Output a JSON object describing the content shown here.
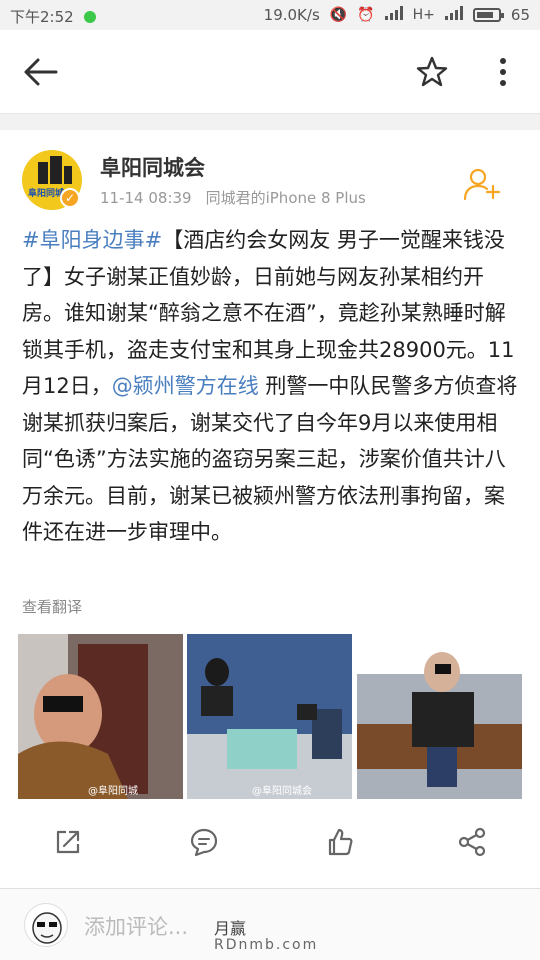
{
  "status_bar": {
    "time": "下午2:52",
    "speed": "19.0K/s",
    "network": "H+",
    "battery": "65"
  },
  "post": {
    "author": "阜阳同城会",
    "avatar_text": "阜阳同城",
    "time": "11-14 08:39",
    "source": "同城君的iPhone 8 Plus",
    "hashtag": "#阜阳身边事#",
    "text_part1": "【酒店约会女网友 男子一觉醒来钱没了】女子谢某正值妙龄，日前她与网友孙某相约开房。谁知谢某“醉翁之意不在酒”，竟趁孙某熟睡时解锁其手机，盗走支付宝和其身上现金共28900元。11月12日，",
    "mention": "@颍州警方在线",
    "text_part2": " 刑警一中队民警多方侦查将谢某抓获归案后，谢某交代了自今年9月以来使用相同“色诱”方法实施的盗窃另案三起，涉案价值共计八万余元。目前，谢某已被颍州警方依法刑事拘留，案件还在进一步审理中。",
    "translate": "查看翻译",
    "photo_watermark_1": "@阜阳同城",
    "photo_watermark_2": "@阜阳同城会"
  },
  "comment_bar": {
    "placeholder": "添加评论...",
    "watermark_top": "月赢",
    "watermark_bottom": "RDnmb.com"
  },
  "icons": {
    "back": "back-arrow-icon",
    "star": "star-icon",
    "more": "more-vertical-icon",
    "follow": "add-user-icon",
    "repost": "repost-icon",
    "comment": "comment-icon",
    "like": "like-icon",
    "share": "share-icon"
  },
  "colors": {
    "link": "#4a7fbf",
    "accent": "#f6a623",
    "text": "#222222",
    "meta": "#999999"
  }
}
